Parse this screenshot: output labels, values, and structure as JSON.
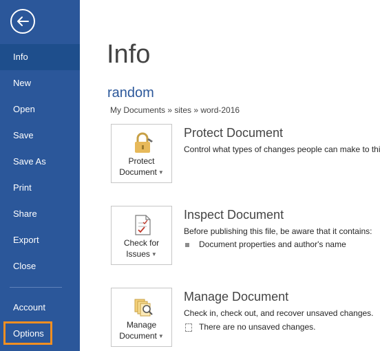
{
  "sidebar": {
    "items": [
      {
        "label": "Info"
      },
      {
        "label": "New"
      },
      {
        "label": "Open"
      },
      {
        "label": "Save"
      },
      {
        "label": "Save As"
      },
      {
        "label": "Print"
      },
      {
        "label": "Share"
      },
      {
        "label": "Export"
      },
      {
        "label": "Close"
      }
    ],
    "bottom": [
      {
        "label": "Account"
      },
      {
        "label": "Options"
      }
    ],
    "active": "Info",
    "highlighted": "Options"
  },
  "main": {
    "title": "Info",
    "doc_name": "random",
    "path": "My Documents » sites » word-2016",
    "sections": [
      {
        "tile_line1": "Protect",
        "tile_line2": "Document",
        "icon": "lock-icon",
        "title": "Protect Document",
        "desc": "Control what types of changes people can make to thi"
      },
      {
        "tile_line1": "Check for",
        "tile_line2": "Issues",
        "icon": "inspect-document-icon",
        "title": "Inspect Document",
        "desc": "Before publishing this file, be aware that it contains:",
        "bullet": "Document properties and author's name"
      },
      {
        "tile_line1": "Manage",
        "tile_line2": "Document",
        "icon": "manage-document-icon",
        "title": "Manage Document",
        "desc": "Check in, check out, and recover unsaved changes.",
        "bullet": "There are no unsaved changes."
      }
    ]
  },
  "colors": {
    "sidebar": "#2b579a",
    "active_item": "#1e4e8c",
    "highlight": "#f28f21",
    "accent": "#2b579a"
  }
}
